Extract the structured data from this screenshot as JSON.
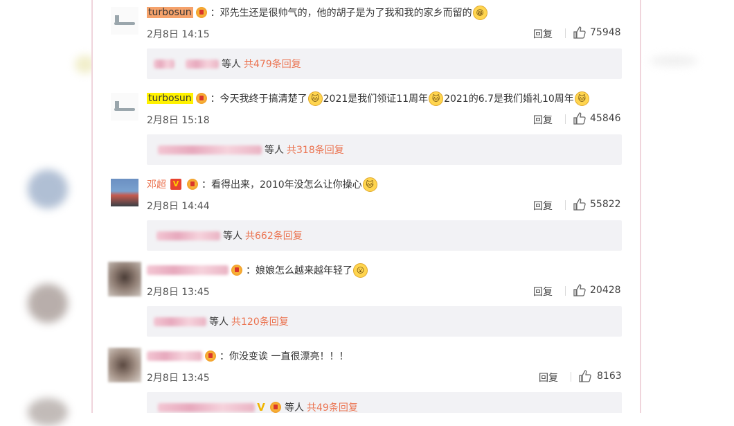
{
  "comments": [
    {
      "username": "turbosun",
      "text": "：邓先生还是很帅气的，他的胡子是为了我和我的家乡而留的",
      "date": "2月8日 14:15",
      "reply_label": "回复",
      "likes": "75948",
      "replies_suffix": "等人",
      "replies_count": "共479条回复"
    },
    {
      "username": "turbosun",
      "text_parts": [
        "：今天我终于搞清楚了",
        "2021是我们领证11周年",
        "2021的6.7是我们婚礼10周年"
      ],
      "date": "2月8日 15:18",
      "reply_label": "回复",
      "likes": "45846",
      "replies_suffix": "等人",
      "replies_count": "共318条回复"
    },
    {
      "username": "邓超",
      "badge": "V",
      "text": "：看得出来，2010年没怎么让你操心",
      "date": "2月8日 14:44",
      "reply_label": "回复",
      "likes": "55822",
      "replies_suffix": "等人",
      "replies_count": "共662条回复"
    },
    {
      "text": "：娘娘怎么越来越年轻了",
      "date": "2月8日 13:45",
      "reply_label": "回复",
      "likes": "20428",
      "replies_suffix": "等人",
      "replies_count": "共120条回复"
    },
    {
      "text": "：你没变诶 一直很漂亮！！！",
      "date": "2月8日 13:45",
      "reply_label": "回复",
      "likes": "8163",
      "replies_badge": "V",
      "replies_suffix": "等人",
      "replies_count": "共49条回复"
    }
  ],
  "colors": {
    "accent": "#eb7350",
    "reply_box_bg": "#f2f2f5",
    "highlight_orange": "#f5a26b",
    "highlight_yellow": "#fff200"
  }
}
